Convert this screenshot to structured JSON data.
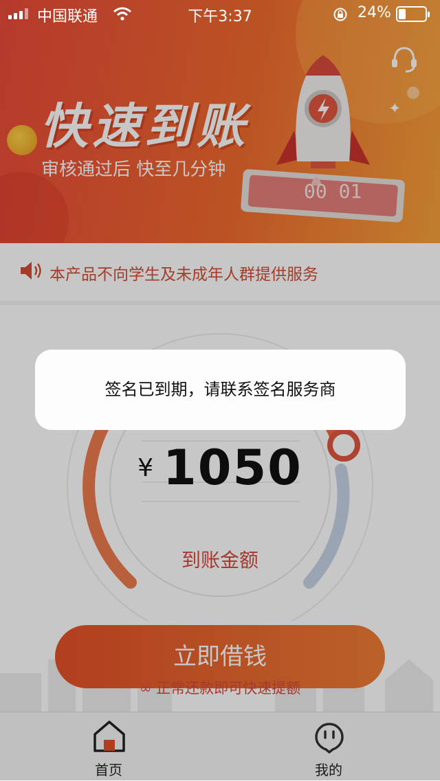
{
  "status_bar": {
    "carrier": "中国联通",
    "time": "下午3:37",
    "battery": "24%"
  },
  "banner": {
    "title": "快速到账",
    "subtitle": "审核通过后 快至几分钟",
    "phone_digits": "00 01"
  },
  "notice": {
    "text": "本产品不向学生及未成年人群提供服务"
  },
  "gauge": {
    "currency": "¥",
    "amount": "1050",
    "label": "到账金额"
  },
  "cta": {
    "button": "立即借钱",
    "hint": "正常还款即可快速提额"
  },
  "tabs": [
    {
      "label": "首页",
      "icon": "home-icon",
      "active": true
    },
    {
      "label": "我的",
      "icon": "profile-face-icon",
      "active": false
    }
  ],
  "toast": {
    "message": "签名已到期，请联系签名服务商"
  },
  "colors": {
    "accent": "#e35128",
    "banner_start": "#ea4a3a",
    "banner_end": "#f7a23a"
  }
}
